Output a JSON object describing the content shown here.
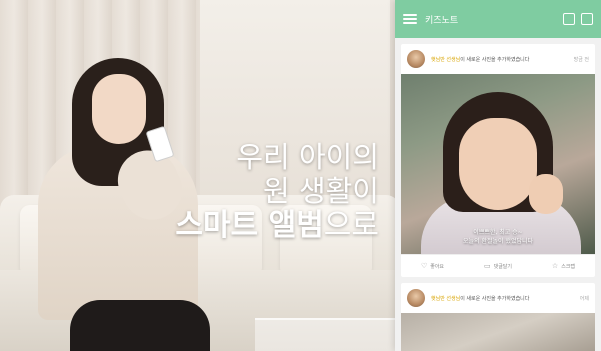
{
  "headline": {
    "line1": "우리 아이의",
    "line2": "원 생활이",
    "line3_bold": "스마트 앨범",
    "line3_rest": "으로"
  },
  "app": {
    "header": {
      "title": "키즈노트"
    },
    "posts": [
      {
        "author_name": "햇님반 선생님",
        "header_text": "이 새로운 사진을 추가하였습니다",
        "time": "방금 전",
        "caption_line1": "이쁘쁘한, 최고 승~",
        "caption_line2": "오늘의 환절놀이 했었답니다",
        "actions": [
          {
            "icon": "heart-icon",
            "label": "좋아요"
          },
          {
            "icon": "comment-icon",
            "label": "댓글달기"
          },
          {
            "icon": "star-icon",
            "label": "스크랩"
          }
        ]
      },
      {
        "author_name": "햇님반 선생님",
        "header_text": "이 새로운 사진을 추가하였습니다",
        "time": "어제"
      }
    ]
  },
  "colors": {
    "appbar": "#7fcca1",
    "highlight": "#d9a400",
    "headline_text": "#ffffff"
  }
}
